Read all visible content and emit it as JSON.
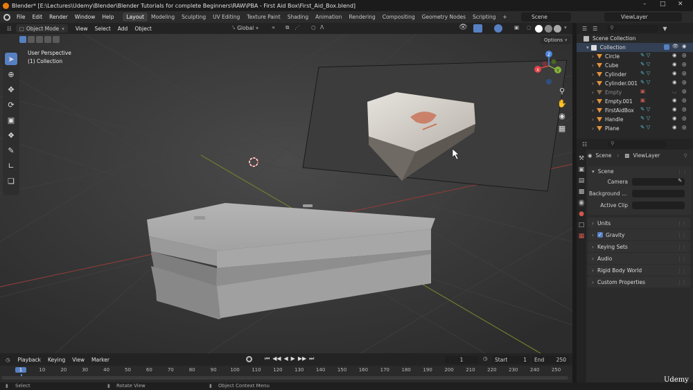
{
  "title_bar": {
    "text": "Blender* [E:\\Lectures\\Udemy\\Blender\\Blender Tutorials for complete Beginners\\RAW\\PBA - First Aid Box\\First_Aid_Box.blend]"
  },
  "menus": [
    "File",
    "Edit",
    "Render",
    "Window",
    "Help"
  ],
  "workspaces": [
    "Layout",
    "Modeling",
    "Sculpting",
    "UV Editing",
    "Texture Paint",
    "Shading",
    "Animation",
    "Rendering",
    "Compositing",
    "Geometry Nodes",
    "Scripting"
  ],
  "active_workspace": "Layout",
  "scene_name": "Scene",
  "view_layer_name": "ViewLayer",
  "viewport_header": {
    "mode": "Object Mode",
    "menus": [
      "View",
      "Select",
      "Add",
      "Object"
    ],
    "orientation": "Global",
    "options": "Options"
  },
  "viewport_overlay": {
    "view_name": "User Perspective",
    "collection": "(1) Collection"
  },
  "gizmo_axes": {
    "x": "X",
    "y": "Y",
    "z": "Z"
  },
  "outliner": {
    "root": "Scene Collection",
    "collection": "Collection",
    "items": [
      "Circle",
      "Cube",
      "Cylinder",
      "Cylinder.001",
      "Empty",
      "Empty.001",
      "FirstAidBox",
      "Handle",
      "Plane"
    ]
  },
  "properties": {
    "breadcrumb_scene": "Scene",
    "breadcrumb_layer": "ViewLayer",
    "scene_panel": "Scene",
    "fields": [
      "Camera",
      "Background ...",
      "Active Clip"
    ],
    "panels": [
      "Units",
      "Gravity",
      "Keying Sets",
      "Audio",
      "Rigid Body World",
      "Custom Properties"
    ],
    "gravity_checked": true
  },
  "timeline": {
    "menus": [
      "Playback",
      "Keying",
      "View",
      "Marker"
    ],
    "current_frame": "1",
    "start_label": "Start",
    "start": "1",
    "end_label": "End",
    "end": "250",
    "ticks": [
      "1",
      "10",
      "20",
      "30",
      "40",
      "50",
      "60",
      "70",
      "80",
      "90",
      "100",
      "110",
      "120",
      "130",
      "140",
      "150",
      "160",
      "170",
      "180",
      "190",
      "200",
      "210",
      "220",
      "230",
      "240",
      "250"
    ],
    "playhead": "1"
  },
  "statusbar": {
    "select": "Select",
    "rotate": "Rotate View",
    "context": "Object Context Menu"
  },
  "watermark": "Udemy",
  "colors": {
    "accent": "#5680c2",
    "orange": "#e87d0d",
    "x_axis": "#e3444b",
    "y_axis": "#86b33a",
    "z_axis": "#4c84d8",
    "mesh_icon": "#e3923b",
    "data_icon": "#5ab9c9"
  }
}
